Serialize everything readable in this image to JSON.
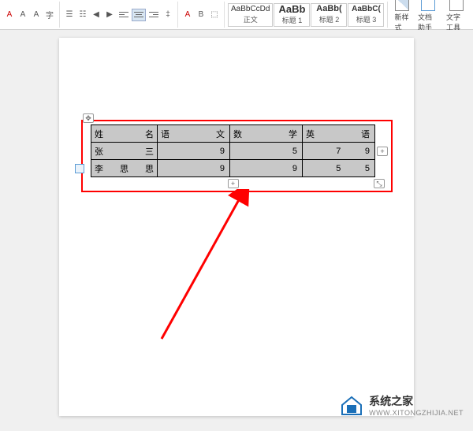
{
  "ribbon": {
    "styles": [
      {
        "preview": "AaBbCcDd",
        "label": "正文"
      },
      {
        "preview": "AaBb",
        "label": "标题 1"
      },
      {
        "preview": "AaBb(",
        "label": "标题 2"
      },
      {
        "preview": "AaBbC(",
        "label": "标题 3"
      }
    ],
    "tools": {
      "new_style": "新样式",
      "doc_helper": "文档助手",
      "text_tool": "文字工具"
    }
  },
  "table": {
    "headers": [
      "姓名",
      "语文",
      "数学",
      "英语"
    ],
    "rows": [
      {
        "name": "张三",
        "scores": [
          9,
          5,
          7,
          9
        ]
      },
      {
        "name": "李思思",
        "scores": [
          9,
          9,
          5,
          5
        ]
      }
    ]
  },
  "watermark": {
    "title": "系统之家",
    "url": "WWW.XITONGZHIJIA.NET"
  }
}
